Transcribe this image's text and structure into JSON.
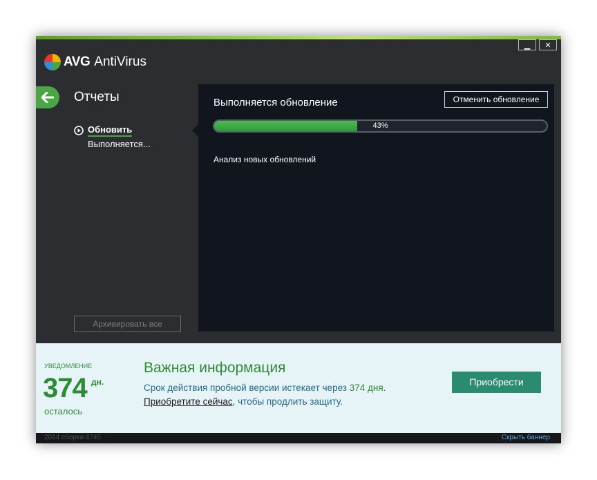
{
  "window": {
    "brand": "AVG",
    "product": "AntiVirus",
    "minimize_glyph": "▁",
    "close_glyph": "✕"
  },
  "colors": {
    "accent_green": "#4aa645",
    "banner_bg": "#e6f3f7",
    "purchase_button": "#2a8b6e",
    "content_bg": "#11151e"
  },
  "sidebar": {
    "title": "Отчеты",
    "items": [
      {
        "label": "Обновить",
        "status": "Выполняется...",
        "icon": "play-circle-icon"
      }
    ],
    "archive_button": "Архивировать все",
    "back_icon": "arrow-left-icon"
  },
  "content": {
    "title": "Выполняется обновление",
    "cancel_button": "Отменить обновление",
    "progress_percent": 43,
    "progress_label": "43%",
    "analysis_text": "Анализ новых обновлений"
  },
  "banner": {
    "notice_label": "УВЕДОМЛЕНИЕ",
    "days": "374",
    "days_unit": "дн.",
    "days_left": "осталось",
    "title": "Важная информация",
    "line1_prefix": "Срок действия пробной версии истекает через ",
    "line1_highlight": "374 дня",
    "line1_suffix": ".",
    "line2_link": "Приобретите сейчас",
    "line2_suffix": ", чтобы продлить защиту.",
    "purchase_button": "Приобрести"
  },
  "footer": {
    "build_info": "2014  сборка 4745",
    "hide_banner": "Скрыть баннер"
  }
}
